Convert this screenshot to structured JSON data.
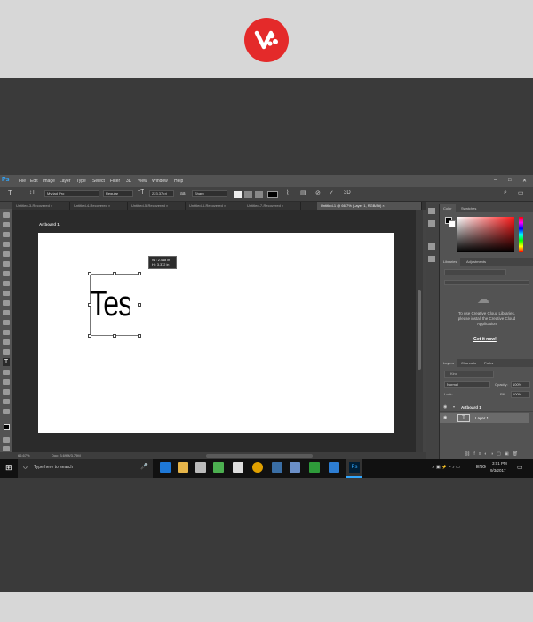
{
  "menu": [
    "File",
    "Edit",
    "Image",
    "Layer",
    "Type",
    "Select",
    "Filter",
    "3D",
    "View",
    "Window",
    "Help"
  ],
  "options": {
    "font_family": "Myriad Pro",
    "font_style": "Regular",
    "font_size": "223.37 pt",
    "aa_label": "aa",
    "antialias": "Sharp"
  },
  "tabs": [
    "Untitled-3-Recovered",
    "Untitled-4-Recovered",
    "Untitled-5-Recovered",
    "Untitled-6-Recovered",
    "Untitled-7-Recovered",
    "Untitled-1 @ 66.7% (Layer 1, RGB/8#)"
  ],
  "canvas": {
    "artboard_label": "Artboard 1",
    "text": "Test",
    "tip_w": "W :  2.448 in",
    "tip_h": "H :  3.372 in"
  },
  "status": {
    "zoom": "66.67%",
    "doc": "Doc: 3.69M/3.79M"
  },
  "panels": {
    "color_tab": "Color",
    "swatches_tab": "Swatches",
    "libraries_tab": "Libraries",
    "adjustments_tab": "Adjustments",
    "cc_message": "To use Creative Cloud Libraries, please install the Creative Cloud Application",
    "get_it_now": "Get it now!",
    "layers_tabs": [
      "Layers",
      "Channels",
      "Paths"
    ],
    "kind": "Kind",
    "blend_mode": "Normal",
    "opacity_label": "Opacity:",
    "opacity": "100%",
    "lock_label": "Lock:",
    "fill_label": "Fill:",
    "fill": "100%",
    "artboard_layer": "Artboard 1",
    "text_layer": "Layer 1",
    "text_thumb": "T"
  },
  "taskbar": {
    "search_placeholder": "Type here to search",
    "lang": "ENG",
    "time": "3:01 PM",
    "date": "9/3/2017"
  },
  "colors": {
    "brand_red": "#e42a2a",
    "ps_blue": "#31a8ff"
  }
}
